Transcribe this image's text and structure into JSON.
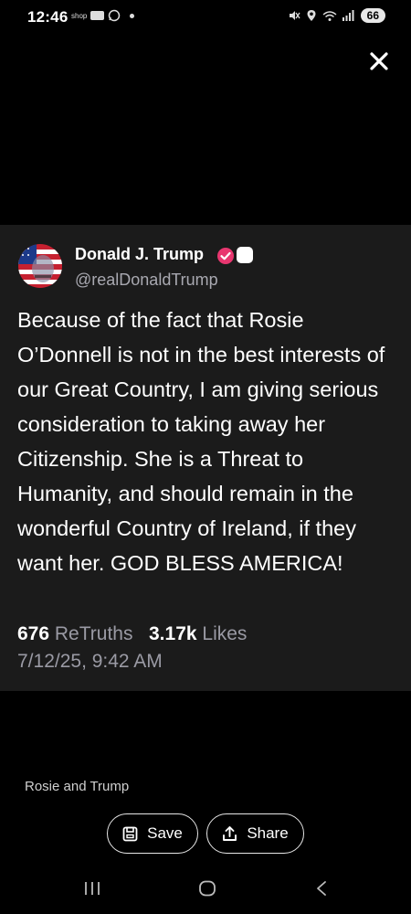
{
  "status_bar": {
    "time": "12:46",
    "shop_label": "shop",
    "battery": "66"
  },
  "post": {
    "display_name": "Donald J. Trump",
    "handle": "@realDonaldTrump",
    "text": "Because of the fact that Rosie O’Donnell is not in the best interests of our Great Country, I am giving serious consideration to taking away her Citizenship. She is a Threat to Humanity, and should remain in the wonderful Country of Ireland, if they want her. GOD BLESS AMERICA!",
    "retruths_count": "676",
    "retruths_label": "ReTruths",
    "likes_count": "3.17k",
    "likes_label": "Likes",
    "timestamp": "7/12/25, 9:42 AM",
    "verified_color": "#e8366f"
  },
  "caption": "Rosie and Trump",
  "actions": {
    "save_label": "Save",
    "share_label": "Share"
  },
  "icons": [
    "close-icon",
    "verified-icon",
    "save-icon",
    "share-icon",
    "recents-icon",
    "home-icon",
    "back-icon"
  ]
}
